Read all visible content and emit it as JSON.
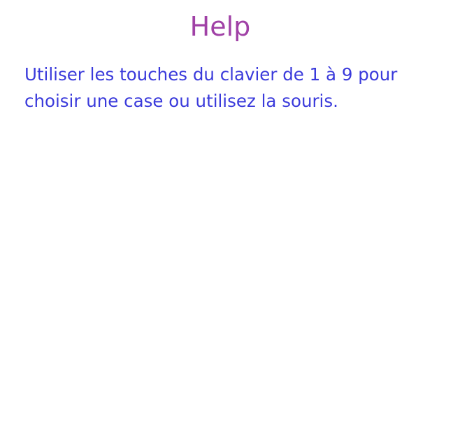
{
  "help": {
    "title": "Help",
    "text": "Utiliser les touches du clavier de 1 à 9 pour choisir une case ou utilisez la souris."
  },
  "colors": {
    "title": "#A041A6",
    "text": "#3A3ADB"
  }
}
